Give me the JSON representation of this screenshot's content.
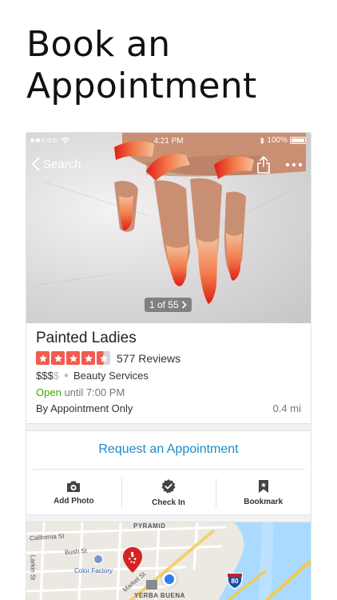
{
  "promo": {
    "title_line1": "Book an",
    "title_line2": "Appointment"
  },
  "status_bar": {
    "time": "4:21 PM",
    "battery": "100%"
  },
  "nav": {
    "back_label": "Search"
  },
  "photo": {
    "counter": "1 of 55"
  },
  "business": {
    "name": "Painted Ladies",
    "rating": 4.5,
    "reviews": "577 Reviews",
    "price_active": "$$$",
    "price_inactive": "$",
    "category": "Beauty Services",
    "open_status": "Open",
    "hours": "until 7:00 PM",
    "appointment_note": "By Appointment Only",
    "distance": "0.4 mi"
  },
  "actions": {
    "request_label": "Request an Appointment",
    "add_photo": "Add Photo",
    "check_in": "Check In",
    "bookmark": "Bookmark"
  },
  "map": {
    "labels": {
      "pyramid": "PYRAMID",
      "california": "California St",
      "bush": "Bush St",
      "larkin": "Larkin St",
      "color_factory": "Color Factory",
      "market": "Market St",
      "yerba_buena": "YERBA BUENA",
      "highway": "80"
    }
  },
  "colors": {
    "accent_red": "#f15c4f",
    "link_blue": "#1a8bc9",
    "open_green": "#41a700",
    "map_water": "#aadaff"
  }
}
